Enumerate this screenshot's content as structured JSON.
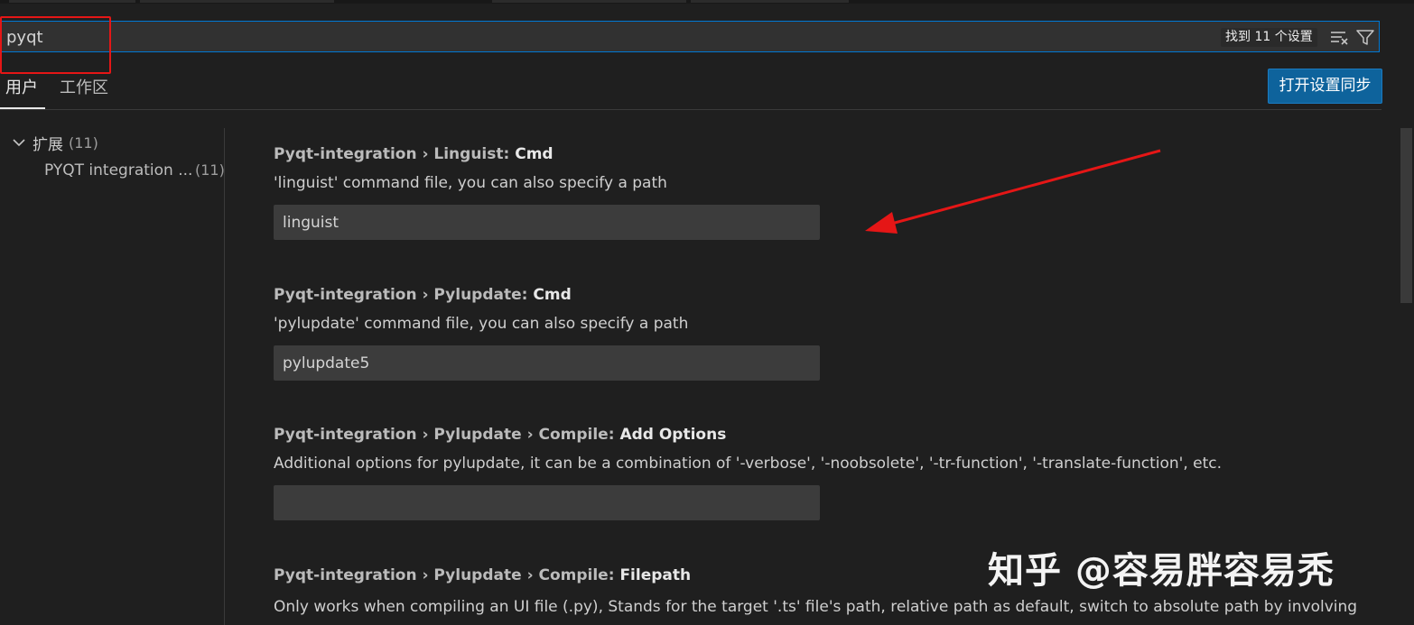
{
  "search": {
    "value": "pyqt",
    "result_count": "找到 11 个设置",
    "icons": [
      "clear-filter-icon",
      "filter-icon"
    ]
  },
  "tabs": [
    {
      "label": "用户",
      "active": true
    },
    {
      "label": "工作区",
      "active": false
    }
  ],
  "sync_button": "打开设置同步",
  "toc": {
    "group_label": "扩展",
    "group_count": "(11)",
    "items": [
      {
        "label": "PYQT integration ...",
        "count": "(11)"
      }
    ]
  },
  "settings": [
    {
      "prefix": "Pyqt-integration › Linguist: ",
      "key": "Cmd",
      "description": "'linguist' command file, you can also specify a path",
      "value": "linguist"
    },
    {
      "prefix": "Pyqt-integration › Pylupdate: ",
      "key": "Cmd",
      "description": "'pylupdate' command file, you can also specify a path",
      "value": "pylupdate5"
    },
    {
      "prefix": "Pyqt-integration › Pylupdate › Compile: ",
      "key": "Add Options",
      "description": "Additional options for pylupdate, it can be a combination of '-verbose', '-noobsolete', '-tr-function', '-translate-function', etc.",
      "value": ""
    },
    {
      "prefix": "Pyqt-integration › Pylupdate › Compile: ",
      "key": "Filepath",
      "description": "Only works when compiling an UI file (.py), Stands for the target '.ts' file's path, relative path as default, switch to absolute path by involving"
    }
  ],
  "watermark": "知乎 @容易胖容易秃",
  "colors": {
    "accent": "#0078d4",
    "button": "#0e639c",
    "annotation": "#e51616"
  }
}
